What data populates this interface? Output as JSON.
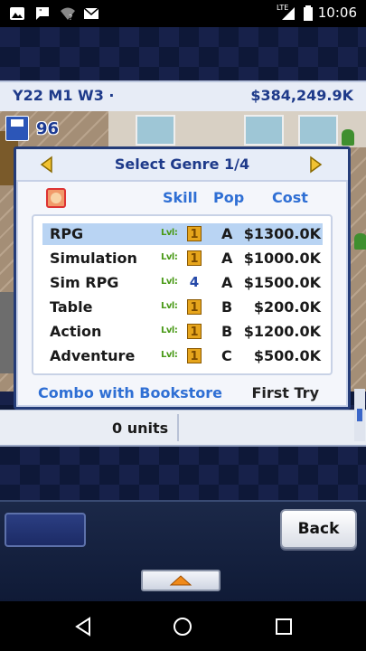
{
  "status_bar": {
    "time": "10:06",
    "network_label": "LTE",
    "icons": [
      "photo-icon",
      "chat-icon",
      "wifi-off-icon",
      "mail-icon",
      "signal-icon",
      "battery-icon"
    ]
  },
  "info_bar": {
    "date": "Y22 M1 W3 ·",
    "money": "$384,249.9K"
  },
  "save_badge": {
    "count": "96"
  },
  "dialog": {
    "title": "Select Genre 1/4",
    "columns": {
      "skill": "Skill",
      "pop": "Pop",
      "cost": "Cost"
    },
    "genres": [
      {
        "name": "RPG",
        "level_label": "Lvl:",
        "level": "1",
        "pop": "A",
        "cost": "$1300.0K",
        "selected": true
      },
      {
        "name": "Simulation",
        "level_label": "Lvl:",
        "level": "1",
        "pop": "A",
        "cost": "$1000.0K",
        "selected": false
      },
      {
        "name": "Sim RPG",
        "level_label": "Lvl:",
        "level": "4",
        "pop": "A",
        "cost": "$1500.0K",
        "selected": false
      },
      {
        "name": "Table",
        "level_label": "Lvl:",
        "level": "1",
        "pop": "B",
        "cost": "$200.0K",
        "selected": false
      },
      {
        "name": "Action",
        "level_label": "Lvl:",
        "level": "1",
        "pop": "B",
        "cost": "$1200.0K",
        "selected": false
      },
      {
        "name": "Adventure",
        "level_label": "Lvl:",
        "level": "1",
        "pop": "C",
        "cost": "$500.0K",
        "selected": false
      }
    ],
    "combo_text": "Combo with Bookstore",
    "combo_result": "First Try"
  },
  "units_strip": {
    "units": "0 units"
  },
  "bottom_panel": {
    "back_label": "Back"
  },
  "colors": {
    "accent_blue": "#2f6fd4",
    "title_blue": "#1e3a8a",
    "selected_row": "#b9d4f3",
    "level_badge": "#e6a51c"
  }
}
